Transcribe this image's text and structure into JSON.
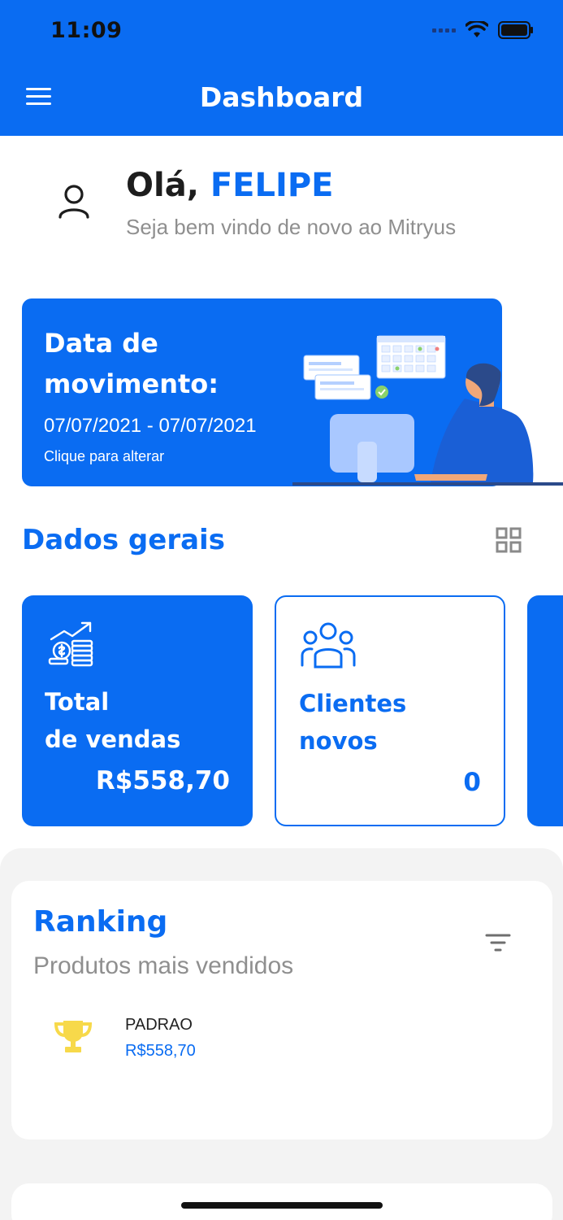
{
  "status_bar": {
    "time": "11:09"
  },
  "header": {
    "title": "Dashboard",
    "menu_icon": "hamburger-menu-icon"
  },
  "greeting": {
    "hello": "Olá,",
    "name": "FELIPE",
    "subtitle": "Seja bem vindo de novo ao Mitryus",
    "icon": "user-icon"
  },
  "date_card": {
    "title": "Data de movimento:",
    "range": "07/07/2021 - 07/07/2021",
    "hint": "Clique para alterar"
  },
  "section": {
    "title": "Dados gerais",
    "grid_icon": "grid-view-icon"
  },
  "stats": [
    {
      "label_line1": "Total",
      "label_line2": "de vendas",
      "value": "R$558,70",
      "icon": "sales-chart-icon"
    },
    {
      "label_line1": "Clientes",
      "label_line2": "novos",
      "value": "0",
      "icon": "group-icon"
    }
  ],
  "ranking": {
    "title": "Ranking",
    "subtitle": "Produtos mais vendidos",
    "filter_icon": "filter-icon",
    "items": [
      {
        "product": "PADRAO",
        "value": "R$558,70",
        "icon": "trophy-icon"
      }
    ]
  },
  "colors": {
    "primary": "#0a6cf2",
    "trophy": "#f7d94a",
    "muted": "#8f8f8f"
  }
}
